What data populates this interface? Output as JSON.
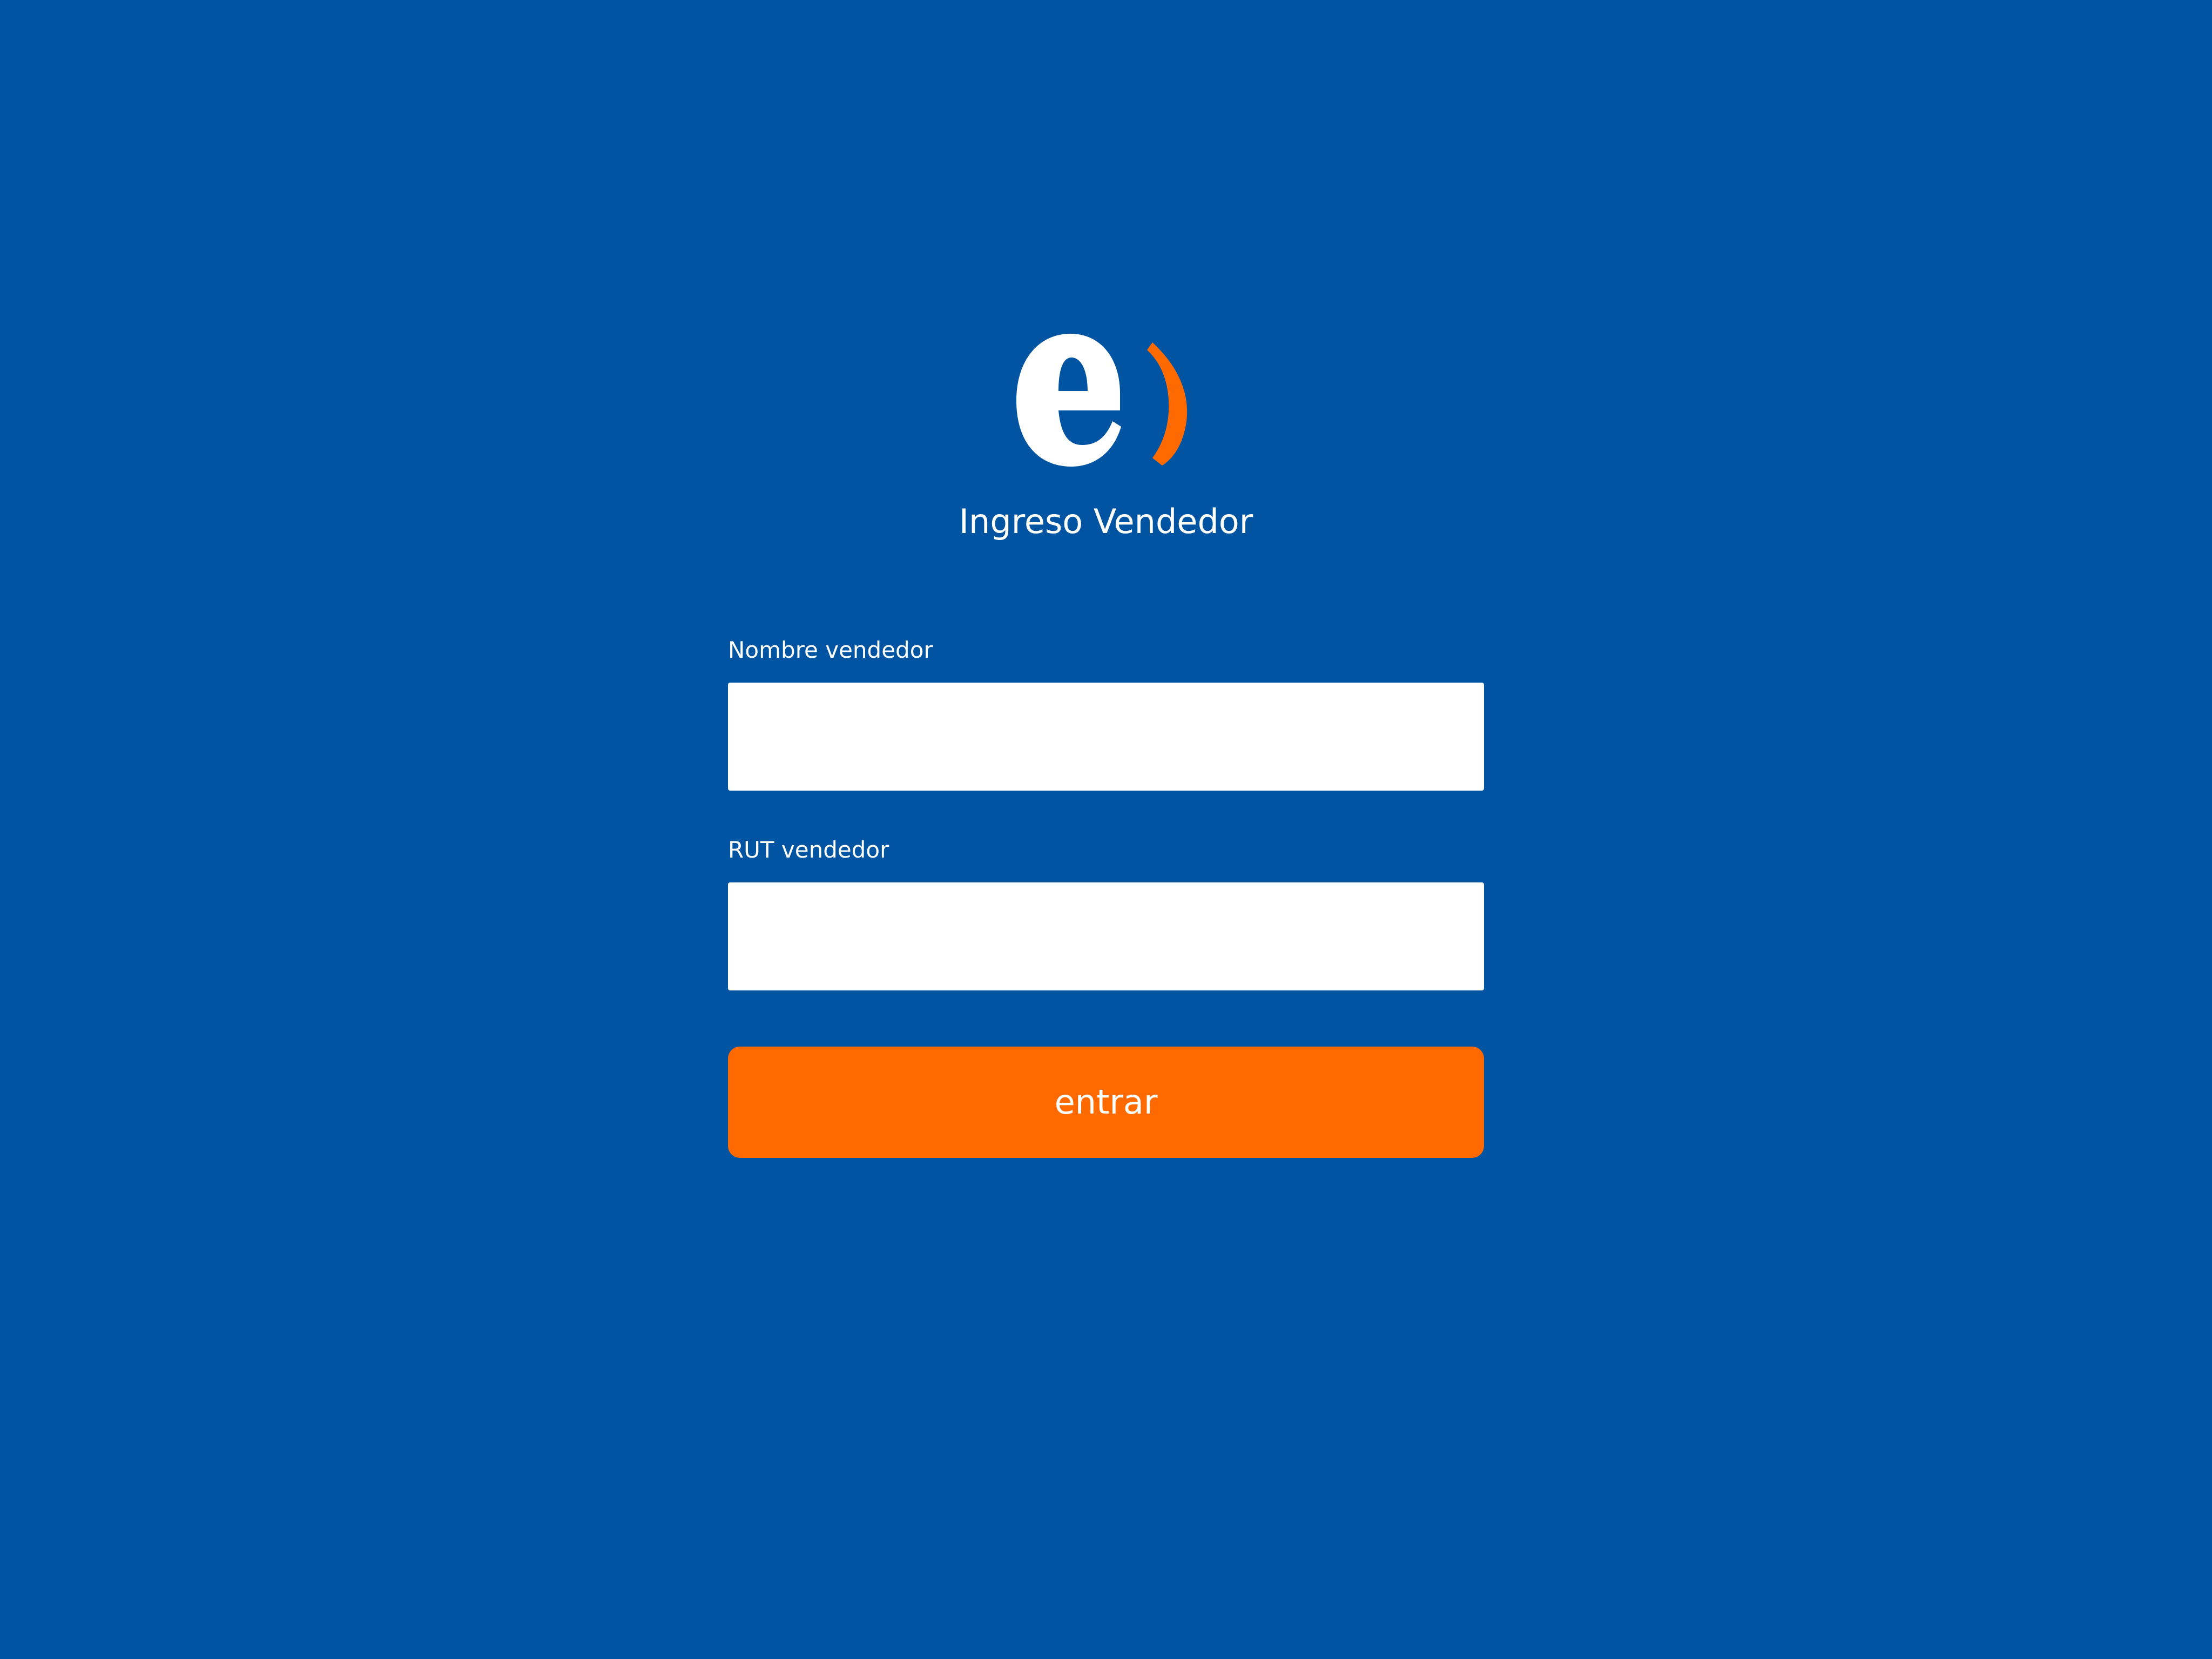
{
  "app": {
    "logo_icon": "enel-e-logo-icon",
    "background_color": "#0054A2",
    "logo_white": "#FFFFFF",
    "logo_accent": "#FF6A00"
  },
  "header": {
    "title": "Ingreso Vendedor"
  },
  "form": {
    "name_label": "Nombre vendedor",
    "name_value": "",
    "rut_label": "RUT vendedor",
    "rut_value": "",
    "submit_label": "entrar",
    "submit_color": "#FF6A00"
  }
}
